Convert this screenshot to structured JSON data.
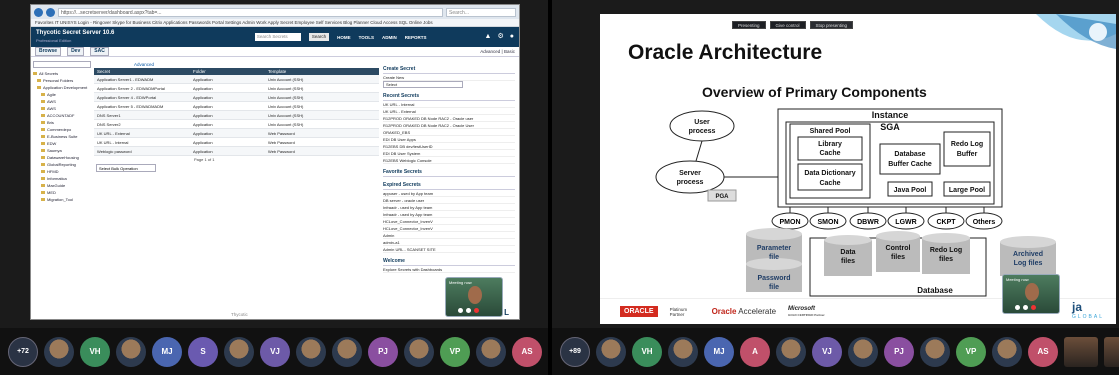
{
  "left_browser": {
    "address_url": "https://...secretserver/dashboard.aspx?tab=...",
    "search_placeholder": "Search...",
    "favorites": "Favorites  IT UNISYS  Login - Ringover  Skype for Business  Citrix Applications  Passwords  Portal  Settings  Admin Work  Apply  Secret Employee Self Services  Blog  Planner  Cloud Access  SQL  Online Jobs",
    "app_title": "Thycotic Secret Server 10.6",
    "app_subtitle": "Professional Edition",
    "search_box": "Search Secrets",
    "search_button": "Search",
    "menu": [
      "HOME",
      "TOOLS",
      "ADMIN",
      "REPORTS"
    ],
    "tabs": [
      "Browse",
      "Dev",
      "SAC"
    ],
    "advanced_link": "Advanced",
    "right_links": "Advanced | Basic",
    "content_label": "+ Content",
    "tree_items": [
      "All Secrets",
      "Personal Folders",
      "Application Development",
      "Agile",
      "AWS",
      "AWS",
      "ACCOUNTADF",
      "Bris",
      "Commerdepo",
      "E-Business Suite",
      "EDW",
      "Saumya",
      "DatawareHousing",
      "GlobalReporting",
      "HFMD",
      "Informatica",
      "MaxGuide",
      "MED",
      "Migration_Tool"
    ],
    "grid_headers": [
      "Secret",
      "Folder",
      "Template"
    ],
    "grid_rows": [
      [
        "Application Server1 - EDWADM",
        "Application",
        "Unix Account (SSH)"
      ],
      [
        "Application Server 2 - EDWADMPortal",
        "Application",
        "Unix Account (SSH)"
      ],
      [
        "Application Server 4 - EDWPortal",
        "Application",
        "Unix Account (SSH)"
      ],
      [
        "Application Server 5 - EDWADMADM",
        "Application",
        "Unix Account (SSH)"
      ],
      [
        "DNS Server1",
        "Application",
        "Unix Account (SSH)"
      ],
      [
        "DNS Server2",
        "Application",
        "Unix Account (SSH)"
      ],
      [
        "UK URL - External",
        "Application",
        "Web Password"
      ],
      [
        "UK URL - Internal",
        "Application",
        "Web Password"
      ],
      [
        "Weblogic password",
        "Application",
        "Web Password"
      ]
    ],
    "pager": "Page 1 of 1",
    "bulk_select": "Select Bulk Operation",
    "create_secret_title": "Create Secret",
    "create_new_label": "Create New",
    "create_select": "Select",
    "recent_title": "Recent Secrets",
    "recent_items": [
      "UK URL - Internal",
      "UK URL - External",
      "R12PROD ORAKED DB Node RAC2 - Oracle user",
      "R12PROD ORAKED DB Node RAC2 - Oracle User",
      "ORAKED_EBS",
      "EDI DB User Apps",
      "R12EBS DB dev/testUserID",
      "EDI DB User System",
      "R12EBS Weblogic Console"
    ],
    "favorite_title": "Favorite Secrets",
    "expired_title": "Expired Secrets",
    "expired_items": [
      "appuser - used by App team",
      "DB server - oracle user",
      "Infraadr - used by App team",
      "Infraadr - used by App team",
      "HCLove_Connector_InvenV",
      "HCLove_Connector_InvenV",
      "Admin",
      "admin-a1",
      "Admin URL - SCANSET SITE"
    ],
    "welcome_title": "Welcome",
    "welcome_text": "Explore Secrets with Dashboards",
    "footer_mid": "Thycotic",
    "footer_logo_a": "J",
    "footer_logo_b": "GLOBAL",
    "self_cam_label": "Meeting now"
  },
  "right_slide": {
    "topbar": [
      "Presenting",
      "Give control",
      "Stop presenting"
    ],
    "title": "Oracle Architecture",
    "subtitle": "Overview of Primary Components",
    "labels": {
      "user_process": [
        "User",
        "process"
      ],
      "server_process": [
        "Server",
        "process"
      ],
      "pga": "PGA",
      "instance": "Instance",
      "sga": "SGA",
      "shared_pool": "Shared Pool",
      "library_cache": [
        "Library",
        "Cache"
      ],
      "data_dict": [
        "Data Dictionary",
        "Cache"
      ],
      "db_buffer": [
        "Database",
        "Buffer Cache"
      ],
      "redo_buffer": [
        "Redo Log",
        "Buffer"
      ],
      "java_pool": "Java Pool",
      "large_pool": "Large Pool",
      "bg_processes": [
        "PMON",
        "SMON",
        "DBWR",
        "LGWR",
        "CKPT",
        "Others"
      ],
      "param_file": [
        "Parameter",
        "file"
      ],
      "password_file": [
        "Password",
        "file"
      ],
      "data_files": [
        "Data",
        "files"
      ],
      "control_files": [
        "Control",
        "files"
      ],
      "redo_files": [
        "Redo Log",
        "files"
      ],
      "archived": [
        "Archived",
        "Log files"
      ],
      "database": "Database"
    },
    "footer": {
      "oracle": "ORACLE",
      "platinum": "Platinum Partner",
      "accelerate_a": "Oracle",
      "accelerate_b": "Accelerate",
      "microsoft": "Microsoft",
      "ms_sub": "GOLD CERTIFIED Partner",
      "jaz": "ja",
      "global": "GLOBAL"
    },
    "self_cam_label": "Meeting now"
  },
  "left_strip": [
    "+72",
    "",
    "VH",
    "",
    "MJ",
    "S",
    "",
    "VJ",
    "",
    "",
    "PJ",
    "",
    "VP",
    "",
    "AS",
    "",
    ""
  ],
  "right_strip": [
    "+89",
    "",
    "VH",
    "",
    "MJ",
    "A",
    "",
    "VJ",
    "",
    "PJ",
    "",
    "VP",
    "",
    "AS",
    "",
    ""
  ],
  "colors": {
    "ss_header": "#0f3a5c",
    "grid_header": "#2c4a63",
    "oracle_red": "#d32b1f",
    "jaz_blue": "#1c4e7a",
    "tile_vh": "#3a8d5b",
    "tile_mj": "#4a66b0",
    "tile_s": "#6a5ab0",
    "tile_vj": "#6d5aa8",
    "tile_pj": "#8a4fa0",
    "tile_vp": "#4f9d54",
    "tile_as": "#c0506a"
  }
}
